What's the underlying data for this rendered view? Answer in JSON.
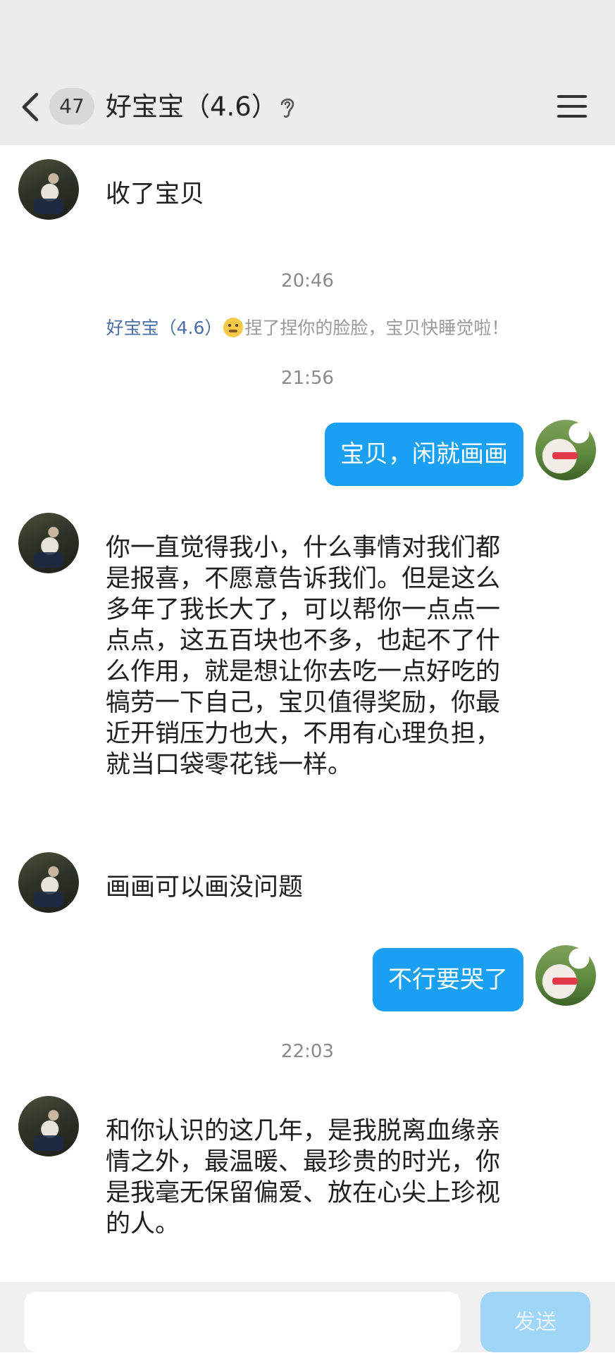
{
  "header": {
    "unread_count": "47",
    "title": "好宝宝（4.6）"
  },
  "messages": [
    {
      "text": "收了宝贝"
    },
    {
      "text": "宝贝，闲就画画"
    },
    {
      "text": "你一直觉得我小，什么事情对我们都是报喜，不愿意告诉我们。但是这么多年了我长大了，可以帮你一点点一点点，这五百块也不多，也起不了什么作用，就是想让你去吃一点好吃的犒劳一下自己，宝贝值得奖励，你最近开销压力也大，不用有心理负担，就当口袋零花钱一样。"
    },
    {
      "text": "画画可以画没问题"
    },
    {
      "text": "不行要哭了"
    },
    {
      "text": "和你认识的这几年，是我脱离血缘亲情之外，最温暖、最珍贵的时光，你是我毫无保留偏爱、放在心尖上珍视的人。"
    }
  ],
  "timestamps": [
    "20:46",
    "21:56",
    "22:03"
  ],
  "system_notice": {
    "who": "好宝宝（4.6）",
    "action": "捏了捏你的脸脸，宝贝快睡觉啦！"
  },
  "input_bar": {
    "send_label": "发送"
  },
  "colors": {
    "bubble_blue": "#1aa0f3",
    "header_bg": "#ececec",
    "send_disabled": "#9fd6f7"
  },
  "icons": [
    "back-arrow-icon",
    "ear-icon",
    "menu-icon",
    "smiley-emoji-icon"
  ]
}
